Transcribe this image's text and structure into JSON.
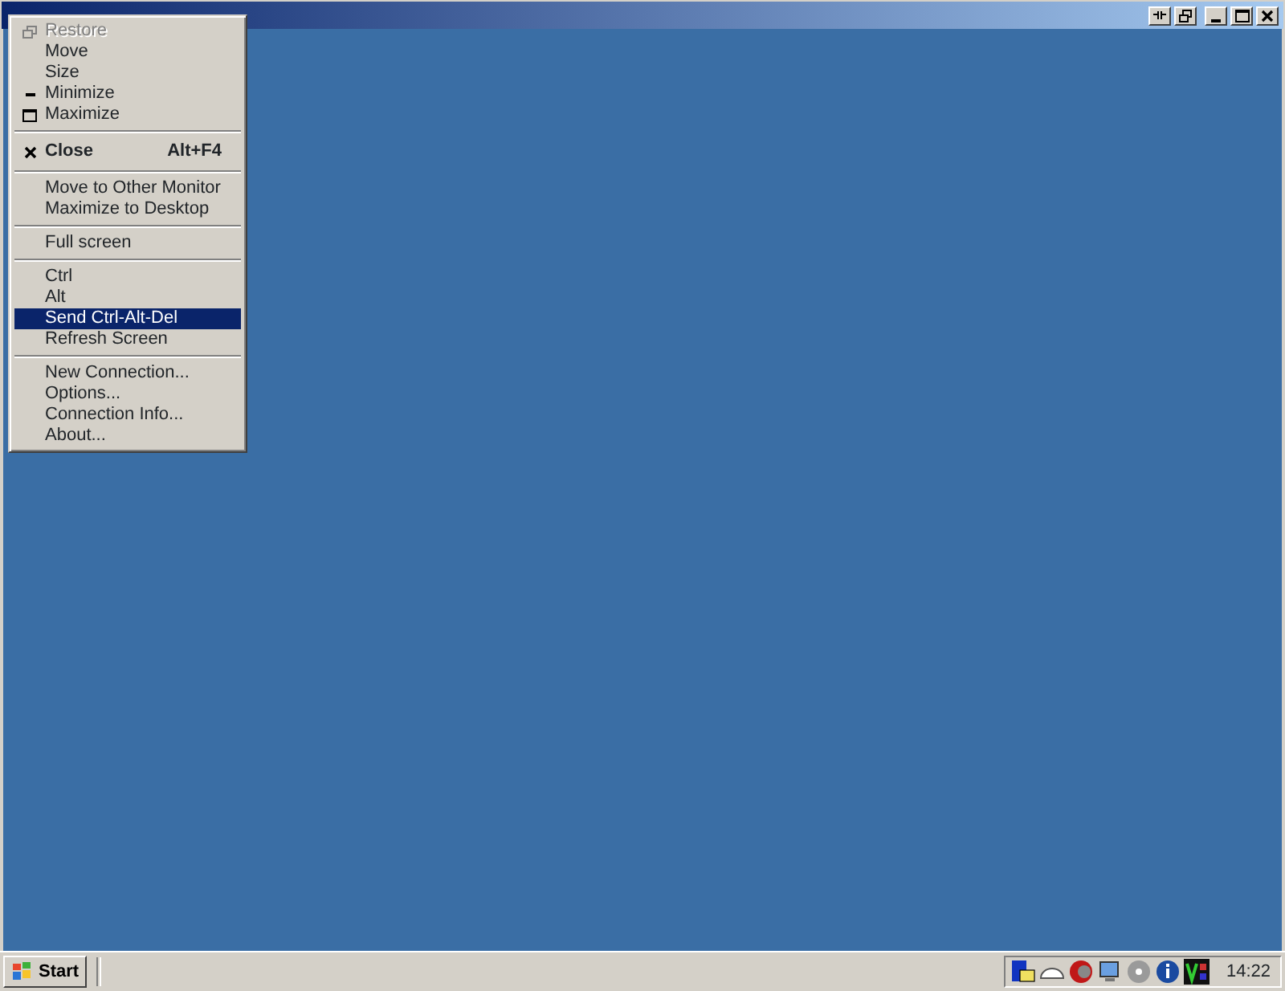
{
  "window": {
    "controls": [
      {
        "kind": "pin"
      },
      {
        "kind": "restore"
      },
      {
        "kind": "minimize"
      },
      {
        "kind": "maximize"
      },
      {
        "kind": "close"
      }
    ]
  },
  "system_menu": {
    "items": [
      {
        "kind": "restore",
        "label": "Restore",
        "disabled": true,
        "selected": false
      },
      {
        "kind": "item",
        "label": "Move",
        "disabled": false,
        "selected": false
      },
      {
        "kind": "item",
        "label": "Size",
        "disabled": false,
        "selected": false
      },
      {
        "kind": "minimize",
        "label": "Minimize",
        "disabled": false,
        "selected": false
      },
      {
        "kind": "maximize",
        "label": "Maximize",
        "disabled": false,
        "selected": false
      },
      {
        "kind": "separator"
      },
      {
        "kind": "close",
        "label": "Close",
        "shortcut": "Alt+F4",
        "disabled": false,
        "selected": false
      },
      {
        "kind": "separator"
      },
      {
        "kind": "item",
        "label": "Move to Other Monitor",
        "disabled": false,
        "selected": false
      },
      {
        "kind": "item",
        "label": "Maximize to Desktop",
        "disabled": false,
        "selected": false
      },
      {
        "kind": "separator"
      },
      {
        "kind": "item",
        "label": "Full screen",
        "disabled": false,
        "selected": false
      },
      {
        "kind": "separator"
      },
      {
        "kind": "item",
        "label": "Ctrl",
        "disabled": false,
        "selected": false
      },
      {
        "kind": "item",
        "label": "Alt",
        "disabled": false,
        "selected": false
      },
      {
        "kind": "item",
        "label": "Send Ctrl-Alt-Del",
        "disabled": false,
        "selected": true
      },
      {
        "kind": "item",
        "label": "Refresh Screen",
        "disabled": false,
        "selected": false
      },
      {
        "kind": "separator"
      },
      {
        "kind": "item",
        "label": "New Connection...",
        "disabled": false,
        "selected": false
      },
      {
        "kind": "item",
        "label": "Options...",
        "disabled": false,
        "selected": false
      },
      {
        "kind": "item",
        "label": "Connection Info...",
        "disabled": false,
        "selected": false
      },
      {
        "kind": "item",
        "label": "About...",
        "disabled": false,
        "selected": false
      }
    ]
  },
  "taskbar": {
    "start_label": "Start",
    "tray_icons": [
      {
        "kind": "network"
      },
      {
        "kind": "cloud"
      },
      {
        "kind": "antivirus"
      },
      {
        "kind": "monitor"
      },
      {
        "kind": "disc"
      },
      {
        "kind": "info"
      },
      {
        "kind": "vnc"
      }
    ],
    "clock": "14:22"
  }
}
